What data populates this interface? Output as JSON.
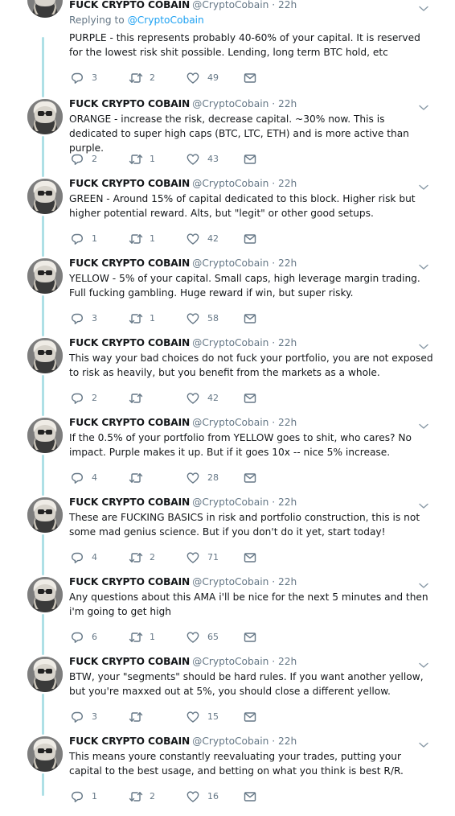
{
  "account": {
    "name": "FUCK CRYPTO COBAIN",
    "handle": "@CryptoCobain",
    "separator": " · "
  },
  "replying": {
    "prefix": "Replying to ",
    "mention": "@CryptoCobain"
  },
  "icons": {
    "reply": "reply-icon",
    "retweet": "retweet-icon",
    "like": "heart-icon",
    "dm": "envelope-icon",
    "more": "chevron-down-icon"
  },
  "colors": {
    "thread_line": "#aee0e6",
    "link": "#1da1f2",
    "muted": "#657786"
  },
  "tweets": [
    {
      "time": "22h",
      "replying": true,
      "text": "PURPLE - this represents probably 40-60% of your capital. It is reserved for the lowest risk shit possible. Lending, long term BTC hold, etc",
      "replies": "3",
      "retweets": "2",
      "likes": "49"
    },
    {
      "time": "22h",
      "text": "ORANGE - increase the risk, decrease capital. ~30% now. This is dedicated to super high caps (BTC, LTC, ETH) and is more active than purple.",
      "replies": "2",
      "retweets": "1",
      "likes": "43"
    },
    {
      "time": "22h",
      "text": "GREEN - Around 15% of capital dedicated to this block. Higher risk but higher potential reward. Alts, but \"legit\" or other good setups.",
      "replies": "1",
      "retweets": "1",
      "likes": "42"
    },
    {
      "time": "22h",
      "text": "YELLOW - 5% of your capital. Small caps, high leverage margin trading. Full fucking gambling. Huge reward if win, but super risky.",
      "replies": "3",
      "retweets": "1",
      "likes": "58"
    },
    {
      "time": "22h",
      "text": "This way your bad choices do not fuck your portfolio, you are not exposed to risk as heavily, but you benefit from the markets as a whole.",
      "replies": "2",
      "retweets": "",
      "likes": "42"
    },
    {
      "time": "22h",
      "text": "If the 0.5% of your portfolio from YELLOW goes to shit, who cares? No impact. Purple makes it up. But if it goes 10x -- nice 5% increase.",
      "replies": "4",
      "retweets": "",
      "likes": "28"
    },
    {
      "time": "22h",
      "text": "These are FUCKING BASICS in risk and portfolio construction, this is not some mad genius science. But if you don't do it yet, start today!",
      "replies": "4",
      "retweets": "2",
      "likes": "71"
    },
    {
      "time": "22h",
      "text": "Any questions about this AMA i'll be nice for the next 5 minutes and then i'm going to get high",
      "replies": "6",
      "retweets": "1",
      "likes": "65"
    },
    {
      "time": "22h",
      "text": "BTW, your \"segments\" should be hard rules. If you want another yellow, but you're maxxed out at 5%, you should close a different yellow.",
      "replies": "3",
      "retweets": "",
      "likes": "15"
    },
    {
      "time": "22h",
      "text": "This means youre constantly reevaluating your trades, putting your capital to the best usage, and betting on what you think is best R/R.",
      "replies": "1",
      "retweets": "2",
      "likes": "16"
    }
  ]
}
